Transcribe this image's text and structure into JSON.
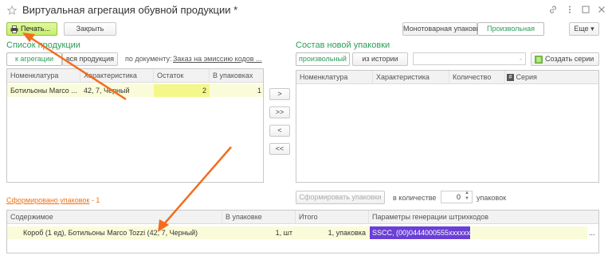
{
  "window": {
    "title": "Виртуальная агрегация обувной продукции *",
    "controls": [
      "link-icon",
      "more-icon",
      "maximize-icon",
      "close-icon"
    ]
  },
  "toolbar": {
    "print_label": "Печать...",
    "close_label": "Закрыть",
    "mono_label": "Монотоварная упаковка",
    "arbitrary_label": "Произвольная",
    "more_label": "Еще",
    "more_arrow": "▾"
  },
  "left": {
    "section_title": "Список продукции",
    "tab_aggregation": "к агрегации",
    "tab_all": "вся продукция",
    "by_document_label": "по документу:",
    "document_link": "Заказ на эмиссию кодов ...",
    "columns": [
      "Номенклатура",
      "Характеристика",
      "Остаток",
      "В упаковках"
    ],
    "rows": [
      {
        "nomenclature": "Ботильоны Marco ...",
        "characteristic": "42, 7, Черный",
        "remainder": "2",
        "in_packages": "1"
      }
    ]
  },
  "transfer_buttons": [
    ">",
    ">>",
    "<",
    "<<"
  ],
  "right": {
    "section_title": "Состав новой упаковки",
    "tab_arbitrary": "произвольный",
    "tab_history": "из истории",
    "create_series_label": "Создать серии",
    "columns": [
      "Номенклатура",
      "Характеристика",
      "Количество",
      "Серия"
    ],
    "form_button": "Сформировать упаковки",
    "quantity_label": "в количестве",
    "quantity_value": "0",
    "packages_label": "упаковок"
  },
  "formed": {
    "title": "Сформировано упаковок",
    "count_text": " - 1",
    "columns": [
      "Содержимое",
      "В упаковке",
      "Итого",
      "Параметры генерации штрихкодов"
    ],
    "rows": [
      {
        "content": "Короб (1 ед), Ботильоны Marco Tozzi (42, 7, Черный)",
        "in_package": "1, шт",
        "total": "1, упаковка",
        "barcode": "SSCC, (00)0444000555xxxxxxxx",
        "ellipsis": "..."
      }
    ]
  },
  "colors": {
    "accent_green": "#2a9d57",
    "link_blue": "#2b5aa8",
    "print_button": "#c6ee6a",
    "row_highlight": "#fafcd9",
    "annotation_arrow": "#f36d1e",
    "barcode_highlight": "#6a3fd6"
  }
}
